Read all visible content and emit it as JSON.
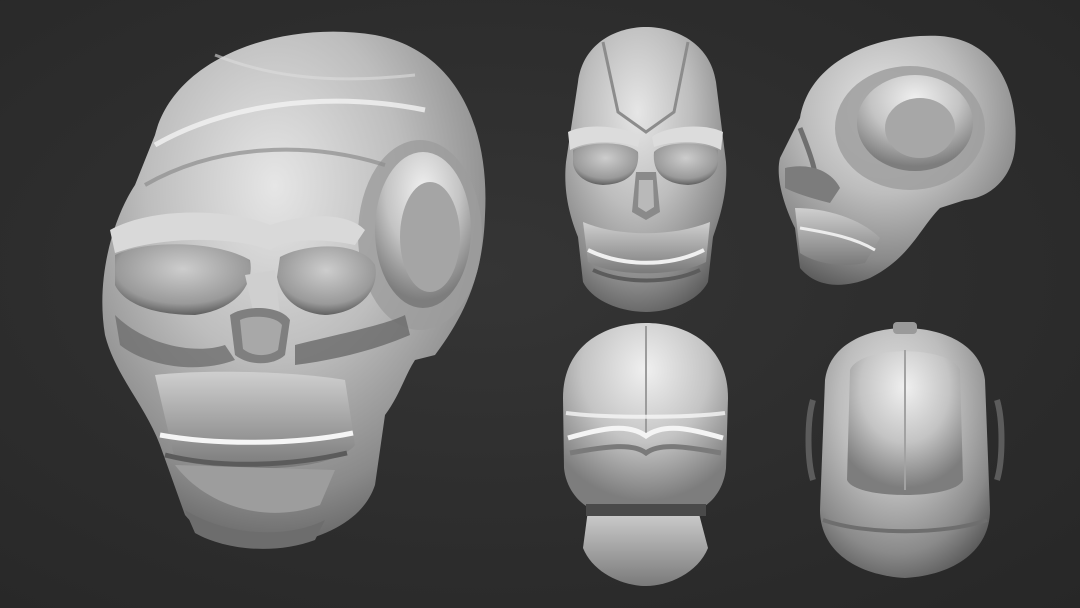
{
  "scene": {
    "background_color": "#2e2e2e",
    "material_color": "#b8b8b8",
    "views": [
      {
        "id": "main",
        "angle": "three-quarter"
      },
      {
        "id": "front",
        "angle": "front"
      },
      {
        "id": "side",
        "angle": "side"
      },
      {
        "id": "back",
        "angle": "back"
      },
      {
        "id": "top",
        "angle": "top"
      }
    ]
  }
}
